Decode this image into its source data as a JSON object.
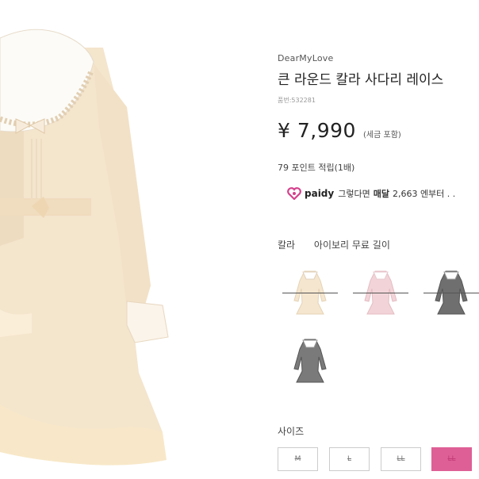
{
  "product": {
    "brand": "DearMyLove",
    "title": "큰 라운드 칼라 사다리 레이스",
    "code": "품번:532281",
    "price": "¥ 7,990",
    "tax_note": "(세금 포함)",
    "points": "79 포인트 적립(1배)"
  },
  "paidy": {
    "logo": "paidy",
    "text_before": "그렇다면",
    "bold": "매달",
    "text_after": "2,663 엔부터 . ."
  },
  "color": {
    "label": "칼라",
    "selected": "아이보리 무료 길이",
    "options": [
      "ivory-dress-thumb",
      "pink-dress-thumb",
      "gray-dress-thumb",
      "gray-dress-thumb-2"
    ]
  },
  "size": {
    "label": "사이즈",
    "options": [
      "M",
      "L",
      "LL",
      "LL"
    ]
  },
  "colors": {
    "accent": "#de5f96",
    "dress_ivory": "#f5e6cf",
    "dress_pink": "#f2d4d8",
    "dress_gray": "#6f6f6f"
  }
}
